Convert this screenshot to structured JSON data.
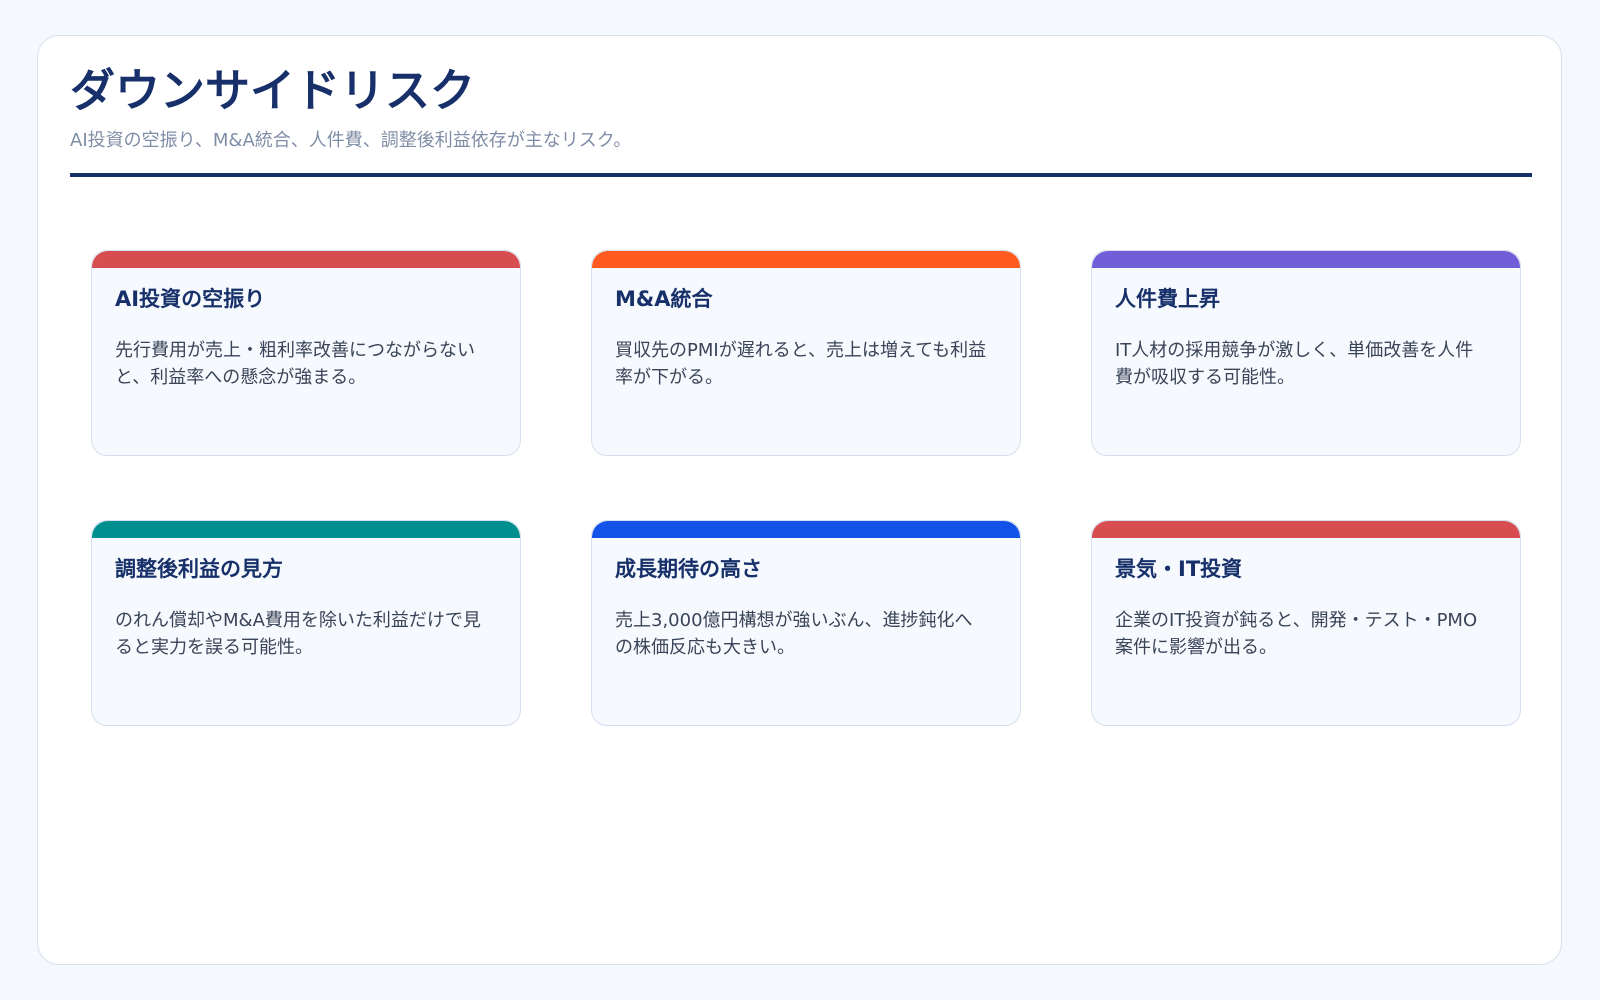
{
  "slide": {
    "title": "ダウンサイドリスク",
    "subtitle": "AI投資の空振り、M&A統合、人件費、調整後利益依存が主なリスク。",
    "rule_color": "#17306a"
  },
  "cards": [
    {
      "title": "AI投資の空振り",
      "body": "先行費用が売上・粗利率改善につながらないと、利益率への懸念が強まる。",
      "accent_color": "#d84d4f"
    },
    {
      "title": "M&A統合",
      "body": "買収先のPMIが遅れると、売上は増えても利益率が下がる。",
      "accent_color": "#ff5a1f"
    },
    {
      "title": "人件費上昇",
      "body": "IT人材の採用競争が激しく、単価改善を人件費が吸収する可能性。",
      "accent_color": "#725ed8"
    },
    {
      "title": "調整後利益の見方",
      "body": "のれん償却やM&A費用を除いた利益だけで見ると実力を誤る可能性。",
      "accent_color": "#008f8f"
    },
    {
      "title": "成長期待の高さ",
      "body": "売上3,000億円構想が強いぶん、進捗鈍化への株価反応も大きい。",
      "accent_color": "#1453e8"
    },
    {
      "title": "景気・IT投資",
      "body": "企業のIT投資が鈍ると、開発・テスト・PMO案件に影響が出る。",
      "accent_color": "#d84d4f"
    }
  ]
}
